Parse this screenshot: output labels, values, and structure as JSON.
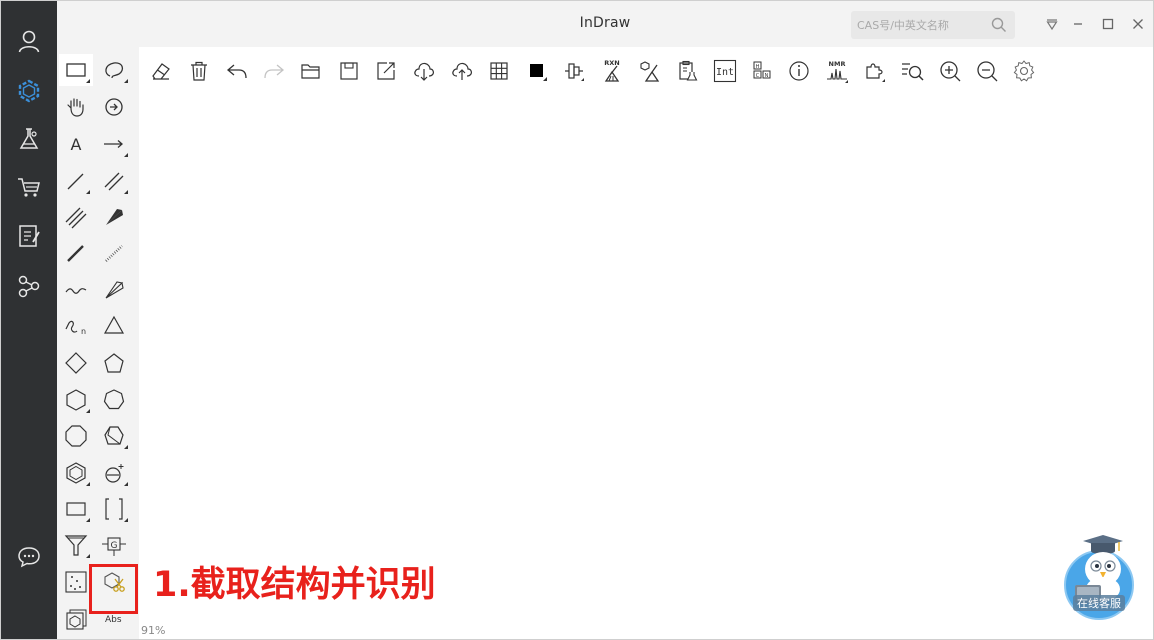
{
  "app": {
    "title": "InDraw"
  },
  "search": {
    "placeholder": "CAS号/中英文名称"
  },
  "window_controls": [
    "menu-dropdown",
    "minimize",
    "maximize",
    "close"
  ],
  "left_rail": {
    "icons": [
      "user-icon",
      "molecule-icon",
      "lab-flask-icon",
      "shopping-cart-icon",
      "notes-icon",
      "network-icon",
      "chat-icon"
    ],
    "active": "molecule-icon",
    "accent_color": "#3b8fd9"
  },
  "toolbar": {
    "icons": [
      "eraser-icon",
      "trash-icon",
      "undo-icon",
      "redo-icon",
      "open-folder-icon",
      "save-icon",
      "export-icon",
      "cloud-download-icon",
      "cloud-upload-icon",
      "grid-table-icon",
      "color-fill-icon",
      "align-icon",
      "reaction-clean-icon",
      "structure-clean-icon",
      "clipboard-flask-icon",
      "int-icon",
      "element-table-icon",
      "info-icon",
      "nmr-icon",
      "plugin-icon",
      "search-structure-icon",
      "zoom-in-icon",
      "zoom-out-icon",
      "settings-icon"
    ],
    "rxn_label": "RXN",
    "int_label": "Int",
    "nmr_label": "NMR"
  },
  "palette": {
    "tools": [
      "selection-rect-tool",
      "lasso-tool",
      "hand-pan-tool",
      "rotate-tool",
      "text-tool",
      "arrow-tool",
      "single-bond-tool",
      "double-bond-tool",
      "triple-bond-tool",
      "wedge-bond-tool",
      "bold-bond-tool",
      "hashed-bond-tool",
      "wavy-bond-tool",
      "hollow-wedge-tool",
      "chain-tool",
      "cyclopropane-tool",
      "cyclobutane-tool",
      "cyclopentane-tool",
      "cyclohexane-tool",
      "cycloheptane-tool",
      "cyclooctane-tool",
      "chair-tool",
      "benzene-tool",
      "charge-tool",
      "rectangle-shape-tool",
      "bracket-tool",
      "funnel-tool",
      "group-tool",
      "dot-matrix-tool",
      "screenshot-recognize-tool",
      "template-tool"
    ],
    "abs_label": "Abs"
  },
  "status": {
    "zoom": "91%"
  },
  "annotation": {
    "text": "1.截取结构并识别",
    "color": "#e8211c"
  },
  "help_widget": {
    "label": "在线客服"
  }
}
